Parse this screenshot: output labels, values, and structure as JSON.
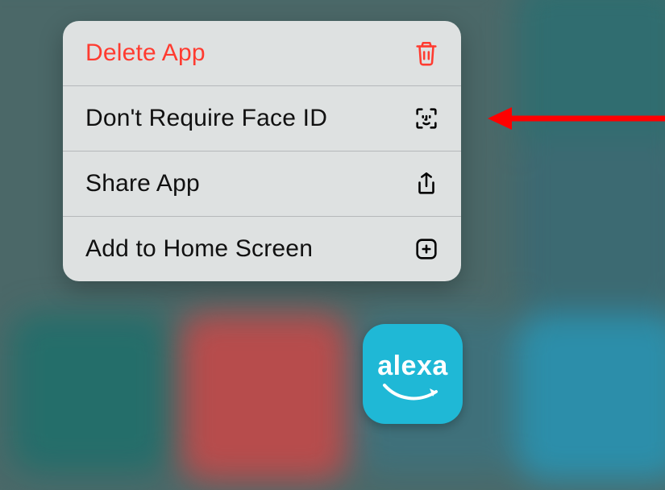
{
  "menu": {
    "items": [
      {
        "label": "Delete App",
        "icon": "trash-icon",
        "danger": true
      },
      {
        "label": "Don't Require Face ID",
        "icon": "faceid-icon",
        "danger": false
      },
      {
        "label": "Share App",
        "icon": "share-icon",
        "danger": false
      },
      {
        "label": "Add to Home Screen",
        "icon": "plus-icon",
        "danger": false
      }
    ]
  },
  "app": {
    "name": "alexa"
  },
  "annotation": {
    "arrow_target_index": 1,
    "arrow_color": "#ff0000"
  },
  "colors": {
    "danger": "#ff3b30",
    "app_icon_bg": "#1fb8d6"
  }
}
